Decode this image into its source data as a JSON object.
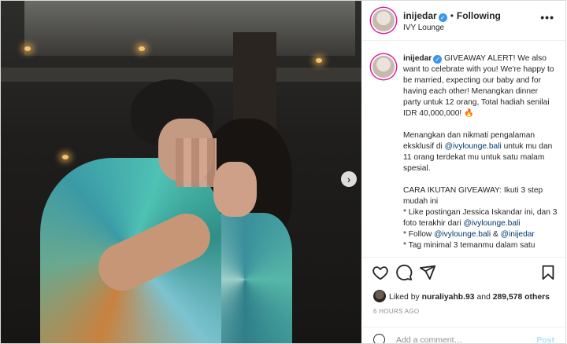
{
  "header": {
    "username": "inijedar",
    "separator": "•",
    "follow_status": "Following",
    "location": "IVY Lounge",
    "more_icon": "more-horizontal-icon"
  },
  "caption": {
    "username": "inijedar",
    "p1": "GIVEAWAY ALERT! We also want to celebrate with you! We're happy to be married, expecting our baby and for having each other! Menangkan dinner party untuk 12 orang, Total hadiah senilai IDR 40,000,000! 🔥",
    "p2_a": "Menangkan dan nikmati pengalaman eksklusif di ",
    "p2_mention": "@ivylounge.bali",
    "p2_b": " untuk mu dan 11 orang terdekat mu untuk satu malam spesial.",
    "p3_title": "CARA IKUTAN GIVEAWAY: Ikuti 3 step mudah ini",
    "p3_l1_a": "* Like postingan Jessica Iskandar ini, dan 3 foto terakhir dari ",
    "p3_l1_mention": "@ivylounge.bali",
    "p3_l2_a": "* Follow ",
    "p3_l2_m1": "@ivylounge.bali",
    "p3_l2_and": " & ",
    "p3_l2_m2": "@inijedar",
    "p3_l3": "* Tag minimal 3 temanmu dalam satu"
  },
  "likes": {
    "prefix": "Liked by ",
    "user": "nuraliyahb.93",
    "middle": " and ",
    "others": "289,578 others"
  },
  "timestamp": "6 HOURS AGO",
  "comment": {
    "placeholder": "Add a comment…",
    "post_label": "Post"
  },
  "colors": {
    "verified": "#3897f0",
    "link": "#00376b",
    "post_disabled": "#b2dffc",
    "story_ring": "#d6249f"
  }
}
